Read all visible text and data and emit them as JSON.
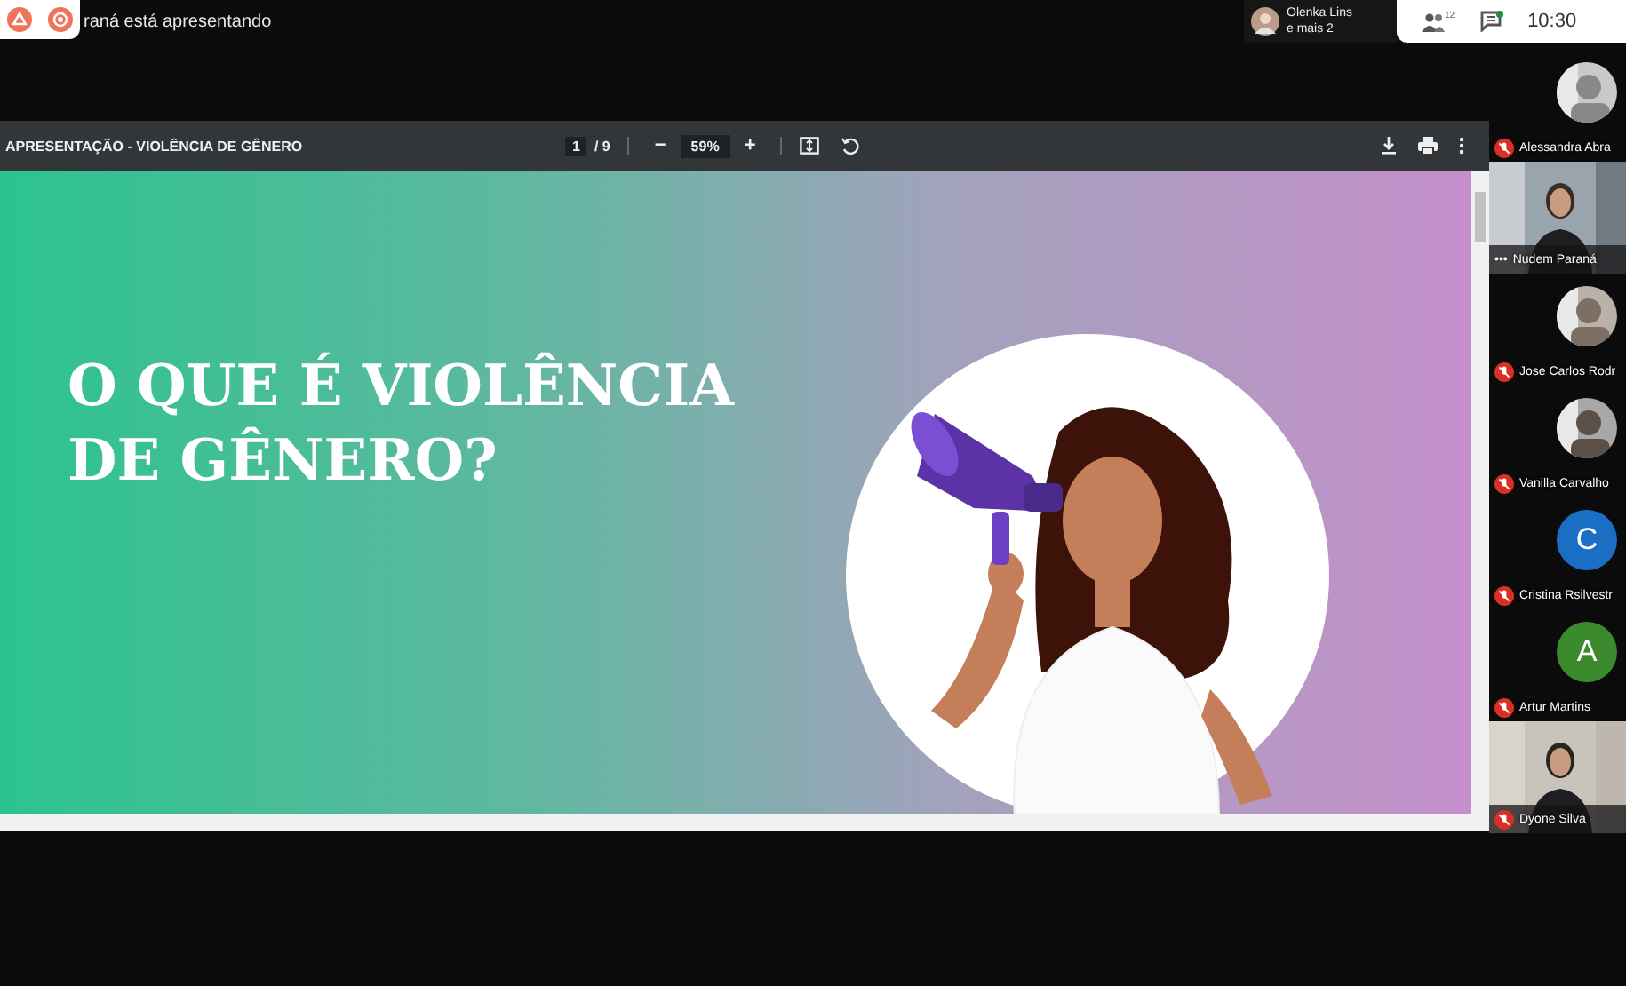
{
  "top_bar": {
    "presenting_text": "raná está apresentando",
    "participants_chip": {
      "name": "Olenka Lins",
      "more": "e mais 2"
    },
    "people_count": "12",
    "chat_unread": true,
    "time": "10:30"
  },
  "pdf_toolbar": {
    "title": "APRESENTAÇÃO - VIOLÊNCIA DE GÊNERO",
    "page": "1",
    "pages": "/ 9",
    "zoom_out": "−",
    "zoom": "59%",
    "zoom_in": "+"
  },
  "slide": {
    "heading_lines": [
      "O QUE É VIOLÊNCIA",
      "DE GÊNERO?"
    ]
  },
  "participants": [
    {
      "name": "Alessandra Abra",
      "muted": true
    },
    {
      "kind": "video",
      "name": "Nudem Paraná",
      "muted": false,
      "menu": "•••"
    },
    {
      "name": "Jose Carlos Rodr",
      "muted": true
    },
    {
      "name": "Vanilla Carvalho",
      "muted": true
    },
    {
      "kind": "letter",
      "letter": "C",
      "color": "#1a6fc4",
      "name": "Cristina Rsilvestr",
      "muted": true
    },
    {
      "kind": "letter",
      "letter": "A",
      "color": "#3c8a2e",
      "name": "Artur Martins",
      "muted": true
    },
    {
      "kind": "video",
      "name": "Dyone Silva",
      "muted": true
    }
  ]
}
